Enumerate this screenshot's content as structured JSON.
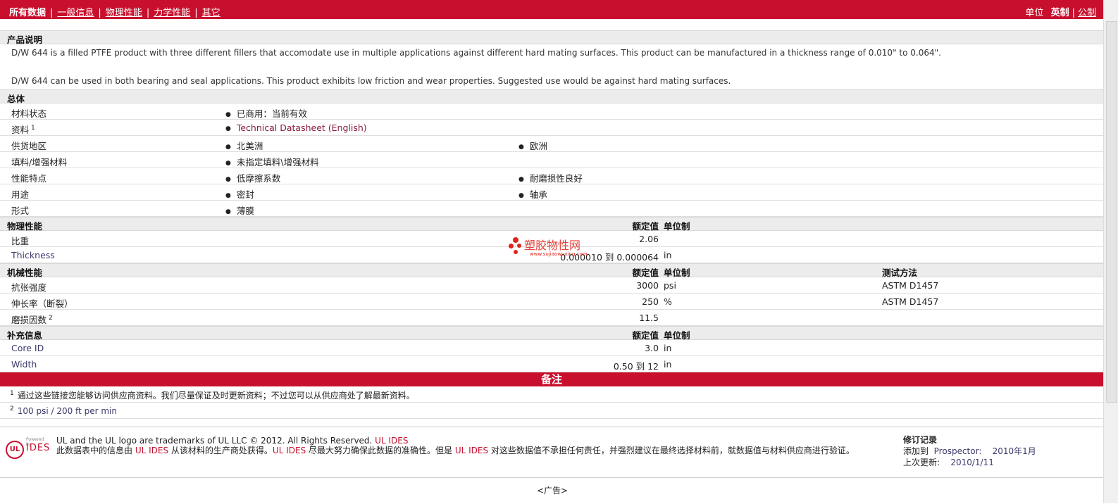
{
  "nav": {
    "items": [
      "所有数据",
      "一般信息",
      "物理性能",
      "力学性能",
      "其它"
    ],
    "units_label": "单位",
    "units": [
      "英制",
      "公制"
    ]
  },
  "description": {
    "title": "产品说明",
    "para1": "D/W 644 is a filled PTFE product with three different fillers that accomodate use in multiple applications against different hard mating surfaces. This product can be manufactured in a thickness range of 0.010\" to 0.064\".",
    "para2": "D/W 644 can be used in both bearing and seal applications. This product exhibits low friction and wear properties. Suggested use would be against hard mating surfaces."
  },
  "general": {
    "title": "总体",
    "rows": [
      {
        "label": "材料状态",
        "sup": "",
        "v1": "已商用：当前有效",
        "v2": ""
      },
      {
        "label": "资料",
        "sup": "1",
        "v1": "Technical Datasheet (English)",
        "v2": ""
      },
      {
        "label": "供货地区",
        "sup": "",
        "v1": "北美洲",
        "v2": "欧洲"
      },
      {
        "label": "填料/增强材料",
        "sup": "",
        "v1": "未指定填料\\增强材料",
        "v2": ""
      },
      {
        "label": "性能特点",
        "sup": "",
        "v1": "低摩擦系数",
        "v2": "耐磨损性良好"
      },
      {
        "label": "用途",
        "sup": "",
        "v1": "密封",
        "v2": "轴承"
      },
      {
        "label": "形式",
        "sup": "",
        "v1": "薄膜",
        "v2": ""
      }
    ]
  },
  "headers": {
    "nominal": "额定值",
    "unit": "单位制",
    "method": "测试方法"
  },
  "physical": {
    "title": "物理性能",
    "rows": [
      {
        "label": "比重",
        "value": "2.06",
        "unit": ""
      },
      {
        "label": "Thickness",
        "value": "0.000010 到  0.000064",
        "unit": "in"
      }
    ]
  },
  "mechanical": {
    "title": "机械性能",
    "rows": [
      {
        "label": "抗张强度",
        "sup": "",
        "value": "3000",
        "unit": "psi",
        "method": "ASTM D1457"
      },
      {
        "label": "伸长率（断裂）",
        "sup": "",
        "value": "250",
        "unit": "%",
        "method": "ASTM D1457"
      },
      {
        "label": "磨损因数",
        "sup": "2",
        "value": "11.5",
        "unit": "",
        "method": ""
      }
    ]
  },
  "supplemental": {
    "title": "补充信息",
    "rows": [
      {
        "label": "Core ID",
        "value": "3.0",
        "unit": "in"
      },
      {
        "label": "Width",
        "value": "0.50 到  12",
        "unit": "in"
      }
    ]
  },
  "notes": {
    "title": "备注",
    "items": [
      {
        "num": "1",
        "text": "通过这些链接您能够访问供应商资料。我们尽量保证及时更新资料；不过您可以从供应商处了解最新资料。"
      },
      {
        "num": "2",
        "text": "100 psi / 200 ft per min"
      }
    ]
  },
  "footer": {
    "logo_small": "Powered by",
    "logo_ul": "UL",
    "logo_text": "IDES",
    "line1a": "UL and the UL logo are trademarks of UL LLC © 2012. All Rights Reserved. ",
    "line1b": "UL IDES",
    "line2a": "此数据表中的信息由 ",
    "line2b": "UL IDES",
    "line2c": " 从该材料的生产商处获得。",
    "line2d": "UL IDES",
    "line2e": " 尽最大努力确保此数据的准确性。但是 ",
    "line2f": "UL IDES",
    "line2g": " 对这些数据值不承担任何责任，并强烈建议在最终选择材料前，就数据值与材料供应商进行验证。",
    "rev_title": "修订记录",
    "rev_added_label": "添加到",
    "rev_added_src": "Prospector:",
    "rev_added_date": "2010年1月",
    "rev_updated_label": "上次更新:",
    "rev_updated_date": "2010/1/11",
    "ad": "<广告>"
  },
  "watermark": {
    "text": "塑胶物性网",
    "url": "www.sujiaowuxing.com"
  },
  "colors": {
    "accent": "#c8102e",
    "section_bg": "#ececec",
    "link": "#8a1c3a"
  }
}
